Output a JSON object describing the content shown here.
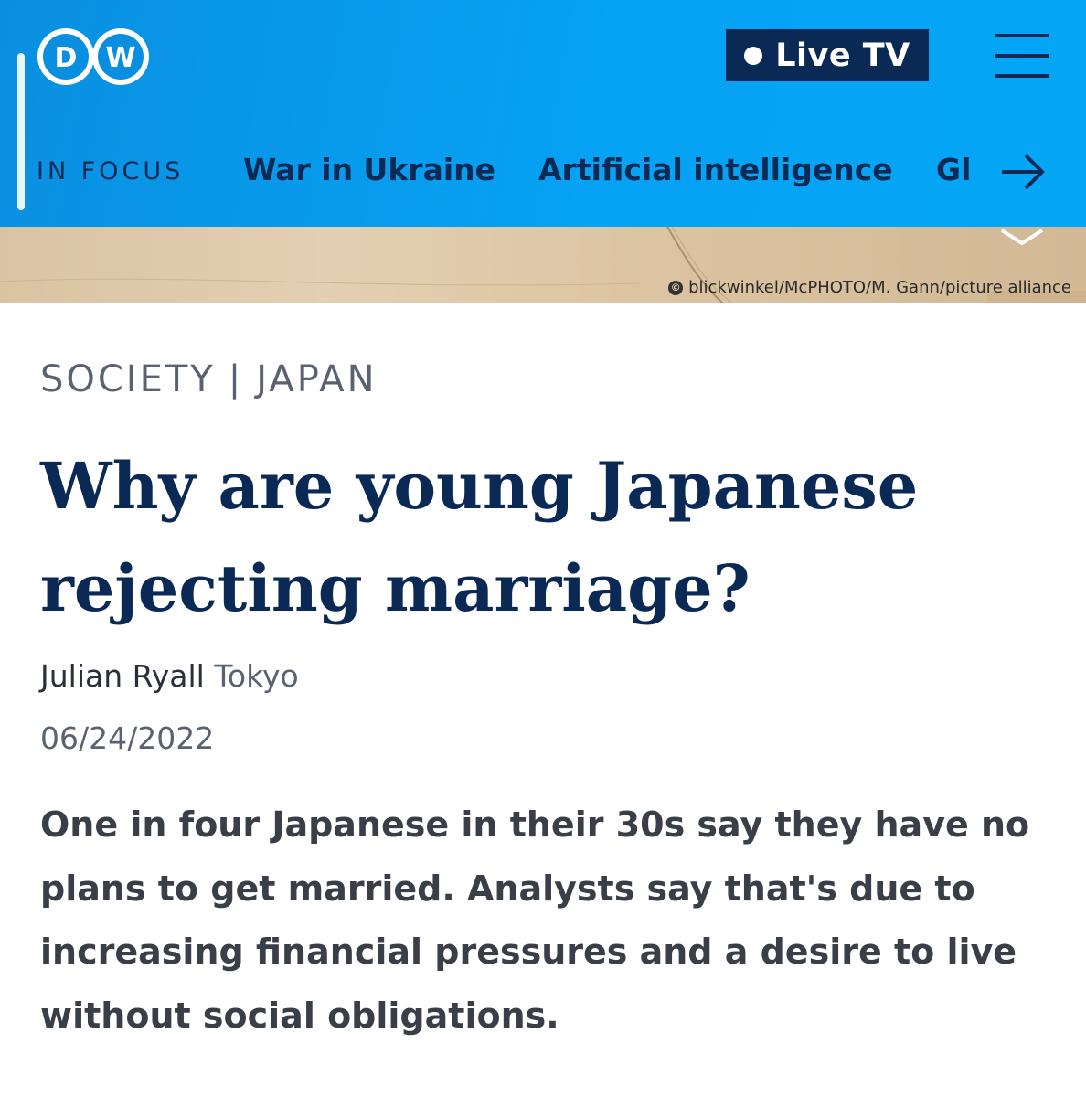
{
  "header": {
    "logo_text": "DW",
    "live_button": "Live TV",
    "in_focus_label": "IN FOCUS",
    "nav": [
      {
        "label": "War in Ukraine"
      },
      {
        "label": "Artificial intelligence"
      },
      {
        "label": "Gl"
      }
    ],
    "icons": [
      "dw-logo-icon",
      "live-dot-icon",
      "menu-icon",
      "arrow-right-icon",
      "chevron-down-icon"
    ]
  },
  "hero": {
    "credit": "blickwinkel/McPHOTO/M. Gann/picture alliance",
    "credit_icon": "copyright-icon"
  },
  "article": {
    "category": "SOCIETY",
    "category_separator": "|",
    "region": "JAPAN",
    "title": "Why are young Japanese rejecting marriage?",
    "author": "Julian Ryall",
    "location": "Tokyo",
    "date": "06/24/2022",
    "teaser": "One in four Japanese in their 30s say they have no plans to get married. Analysts say that's due to increasing financial pressures and a desire to live without social obligations."
  },
  "colors": {
    "header_blue": "#06a2f3",
    "navy": "#0a2a55",
    "text_gray": "#5a6270"
  }
}
